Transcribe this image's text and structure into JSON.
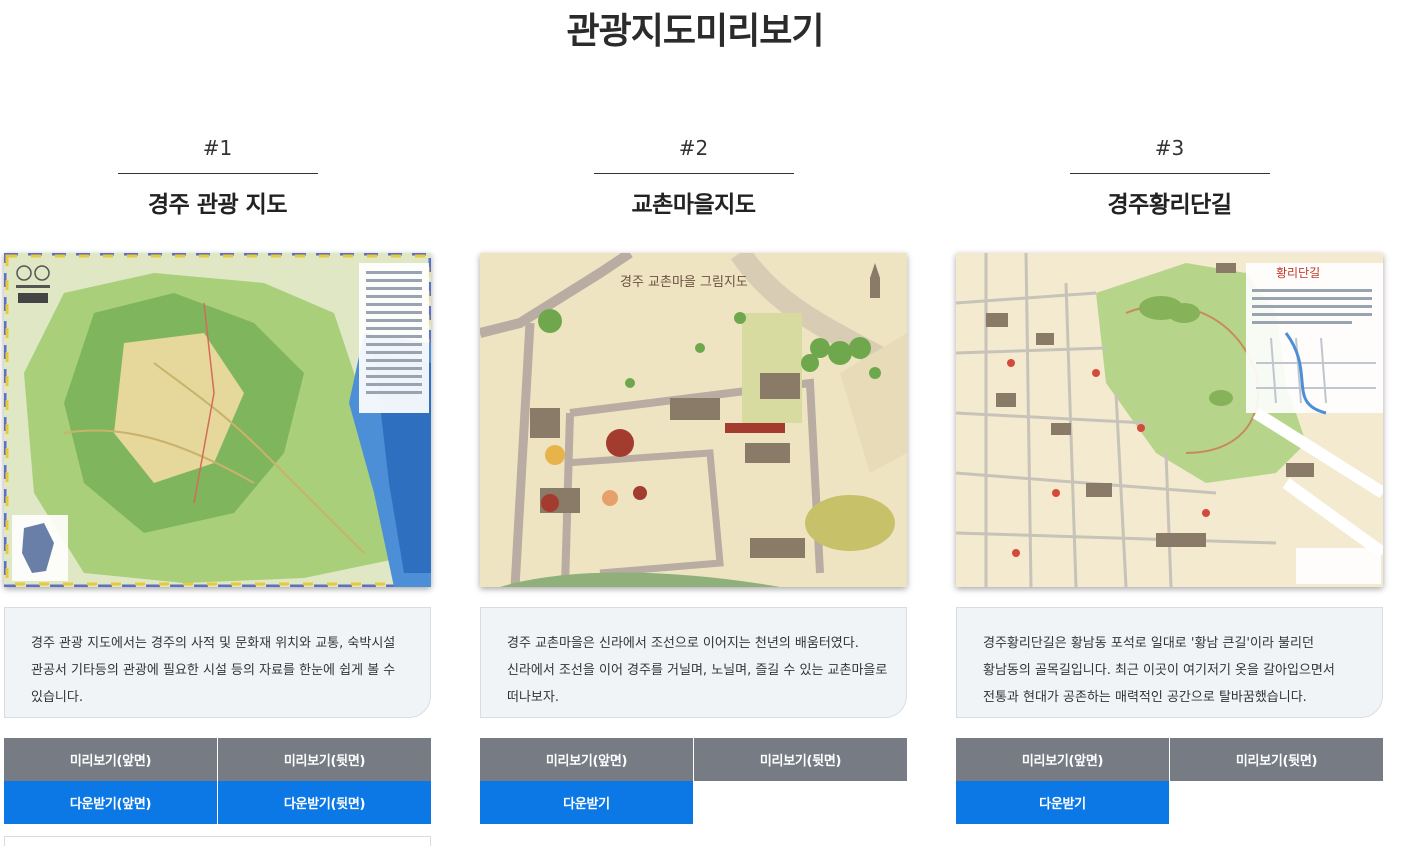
{
  "page": {
    "title": "관광지도미리보기"
  },
  "cards": [
    {
      "number": "#1",
      "name": "경주 관광 지도",
      "description": [
        "경주 관광 지도에서는 경주의 사적 및 문화재 위치와 교통, 숙박시설",
        "관공서 기타등의 관광에 필요한 시설 등의 자료를 한눈에 쉽게 볼 수",
        "있습니다."
      ],
      "buttons": {
        "preview_front": "미리보기(앞면)",
        "preview_back": "미리보기(뒷면)",
        "download_front": "다운받기(앞면)",
        "download_back": "다운받기(뒷면)"
      }
    },
    {
      "number": "#2",
      "name": "교촌마을지도",
      "map_title": "경주 교촌마을 그림지도",
      "description": [
        "경주 교촌마을은 신라에서 조선으로 이어지는 천년의 배움터였다.",
        "신라에서 조선을 이어 경주를 거닐며, 노닐며, 즐길 수 있는 교촌마을로",
        "떠나보자."
      ],
      "buttons": {
        "preview_front": "미리보기(앞면)",
        "preview_back": "미리보기(뒷면)",
        "download": "다운받기"
      }
    },
    {
      "number": "#3",
      "name": "경주황리단길",
      "map_title": "황리단길",
      "description": [
        "경주황리단길은 황남동 포석로 일대로 '황남 큰길'이라 불리던",
        "황남동의 골목길입니다. 최근 이곳이 여기저기 옷을 갈아입으면서",
        "전통과 현대가 공존하는 매력적인 공간으로 탈바꿈했습니다."
      ],
      "buttons": {
        "preview_front": "미리보기(앞면)",
        "preview_back": "미리보기(뒷면)",
        "download": "다운받기"
      }
    }
  ],
  "colors": {
    "button_gray": "#777c84",
    "button_blue": "#0b78e6",
    "desc_bg": "#f1f4f7"
  }
}
